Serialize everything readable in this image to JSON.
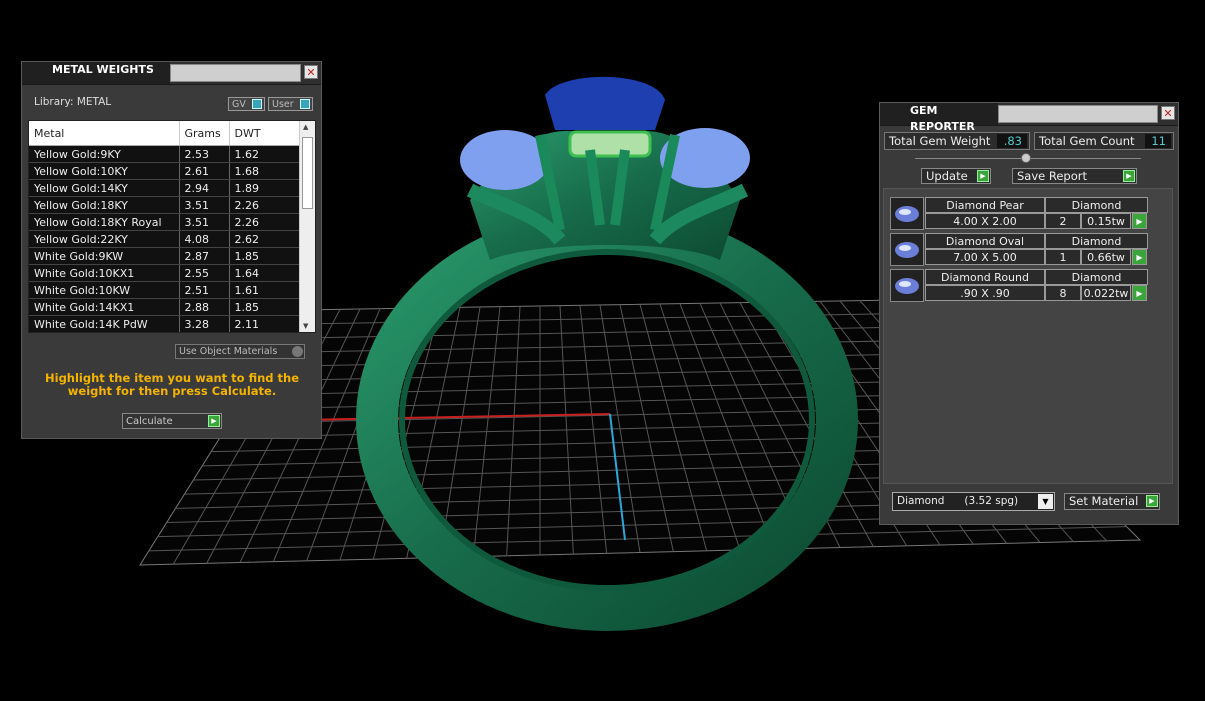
{
  "metal_weights": {
    "title": "METAL WEIGHTS",
    "library_label": "Library: METAL",
    "toggle_gv": "GV",
    "toggle_user": "User",
    "columns": [
      "Metal",
      "Grams",
      "DWT"
    ],
    "rows": [
      {
        "metal": "Yellow Gold:9KY",
        "grams": "2.53",
        "dwt": "1.62"
      },
      {
        "metal": "Yellow Gold:10KY",
        "grams": "2.61",
        "dwt": "1.68"
      },
      {
        "metal": "Yellow Gold:14KY",
        "grams": "2.94",
        "dwt": "1.89"
      },
      {
        "metal": "Yellow Gold:18KY",
        "grams": "3.51",
        "dwt": "2.26"
      },
      {
        "metal": "Yellow Gold:18KY Royal",
        "grams": "3.51",
        "dwt": "2.26"
      },
      {
        "metal": "Yellow Gold:22KY",
        "grams": "4.08",
        "dwt": "2.62"
      },
      {
        "metal": "White Gold:9KW",
        "grams": "2.87",
        "dwt": "1.85"
      },
      {
        "metal": "White Gold:10KX1",
        "grams": "2.55",
        "dwt": "1.64"
      },
      {
        "metal": "White Gold:10KW",
        "grams": "2.51",
        "dwt": "1.61"
      },
      {
        "metal": "White Gold:14KX1",
        "grams": "2.88",
        "dwt": "1.85"
      },
      {
        "metal": "White Gold:14K PdW",
        "grams": "3.28",
        "dwt": "2.11"
      }
    ],
    "use_object_materials": "Use Object Materials",
    "hint": "Highlight the item you want to find the weight for then press Calculate.",
    "calculate_label": "Calculate"
  },
  "gem_reporter": {
    "title": "GEM REPORTER",
    "total_weight_label": "Total Gem Weight",
    "total_weight_value": ".83",
    "total_count_label": "Total Gem Count",
    "total_count_value": "11",
    "update_label": "Update",
    "save_report_label": "Save Report",
    "gems": [
      {
        "name": "Diamond Pear",
        "material": "Diamond",
        "size": "4.00 X 2.00",
        "count": "2",
        "weight": "0.15tw"
      },
      {
        "name": "Diamond Oval",
        "material": "Diamond",
        "size": "7.00 X 5.00",
        "count": "1",
        "weight": "0.66tw"
      },
      {
        "name": "Diamond Round",
        "material": "Diamond",
        "size": ".90 X .90",
        "count": "8",
        "weight": "0.022tw"
      }
    ],
    "material_select": "Diamond      (3.52 spg)",
    "set_material_label": "Set Material"
  },
  "colors": {
    "ring_green": "#1e7a55",
    "gem_blue": "#1e3fb0",
    "accent_yellow": "#f4b400",
    "button_green": "#3aa53a"
  }
}
